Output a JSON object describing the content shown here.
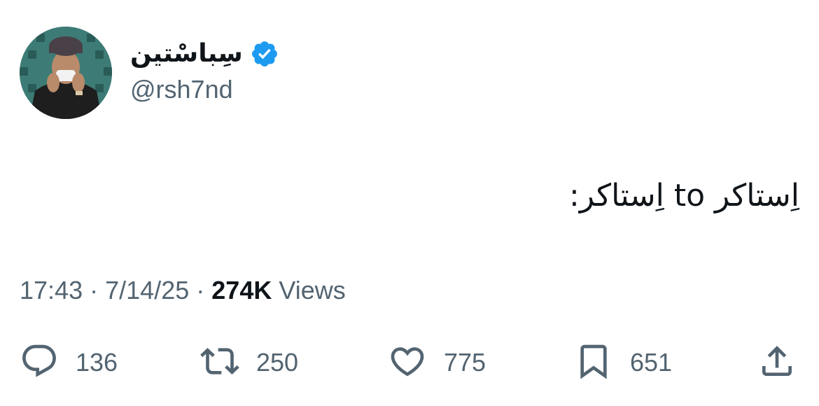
{
  "author": {
    "display_name": "سِباسْتین",
    "handle": "@rsh7nd",
    "verified": true,
    "avatar_icon": "profile-photo"
  },
  "tweet": {
    "text": "اِستاکر to اِستاکر:"
  },
  "meta": {
    "time": "17:43",
    "date": "7/14/25",
    "separator": "·",
    "views_count": "274K",
    "views_label": "Views"
  },
  "actions": {
    "reply": {
      "icon": "reply-icon",
      "count": "136"
    },
    "retweet": {
      "icon": "retweet-icon",
      "count": "250"
    },
    "like": {
      "icon": "heart-icon",
      "count": "775"
    },
    "bookmark": {
      "icon": "bookmark-icon",
      "count": "651"
    },
    "share": {
      "icon": "share-icon"
    }
  },
  "colors": {
    "text_primary": "#0f1419",
    "text_secondary": "#536471",
    "verified_blue": "#1d9bf0"
  }
}
